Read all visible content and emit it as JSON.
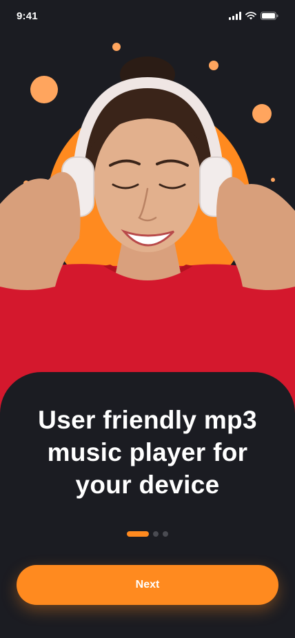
{
  "status_bar": {
    "time": "9:41"
  },
  "onboarding": {
    "headline": "User friendly mp3\nmusic player for\nyour device",
    "pager": {
      "total": 3,
      "active_index": 0
    },
    "next_label": "Next"
  },
  "colors": {
    "accent": "#ff8a1f",
    "background": "#1b1c22",
    "shirt": "#d4182d"
  },
  "icons": [
    "signal-icon",
    "wifi-icon",
    "battery-icon"
  ]
}
